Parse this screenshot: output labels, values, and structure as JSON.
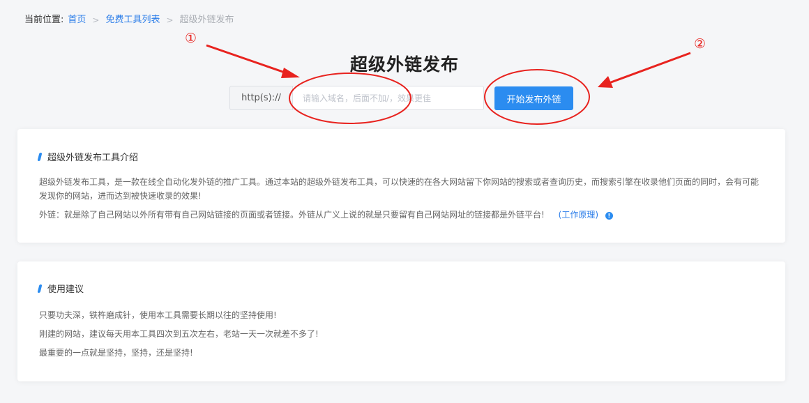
{
  "breadcrumb": {
    "lead": "当前位置:",
    "home": "首页",
    "tools": "免费工具列表",
    "current": "超级外链发布"
  },
  "header": {
    "title": "超级外链发布"
  },
  "search": {
    "prefix": "http(s)://",
    "placeholder": "请输入域名，后面不加/，效果更佳",
    "value": "",
    "button_label": "开始发布外链"
  },
  "annotations": {
    "label1": "①",
    "label2": "②",
    "color": "#e8231f"
  },
  "intro_card": {
    "title": "超级外链发布工具介绍",
    "paragraph": "超级外链发布工具，是一款在线全自动化发外链的推广工具。通过本站的超级外链发布工具，可以快速的在各大网站留下你网站的搜索或者查询历史，而搜索引擎在收录他们页面的同时，会有可能发现你的网站，进而达到被快速收录的效果!",
    "definition": "外链：就是除了自己网站以外所有带有自己网站链接的页面或者链接。外链从广义上说的就是只要留有自己网站网址的链接都是外链平台!",
    "link_label": "(工作原理)",
    "info_icon_text": "!"
  },
  "advice_card": {
    "title": "使用建议",
    "lines": [
      "只要功夫深，铁杵磨成针，使用本工具需要长期以往的坚持使用!",
      "刚建的网站，建议每天用本工具四次到五次左右，老站一天一次就差不多了!",
      "最重要的一点就是坚持，坚持，还是坚持!"
    ]
  },
  "colors": {
    "accent": "#2b8cf0",
    "link": "#2b7de9",
    "background": "#f5f6f8"
  }
}
